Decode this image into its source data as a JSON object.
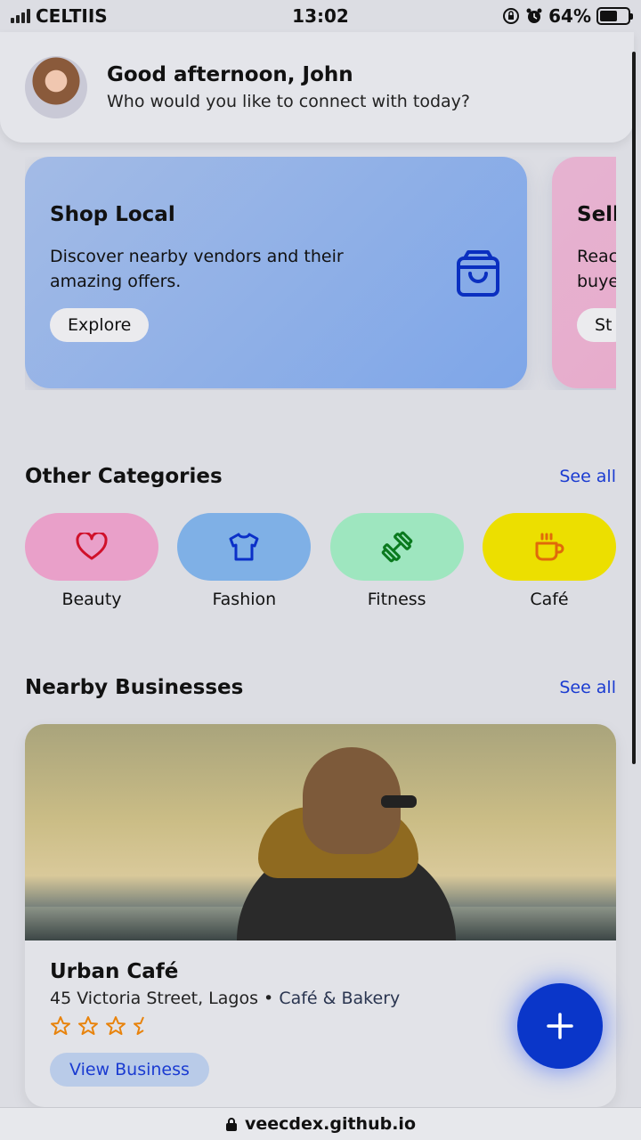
{
  "status_bar": {
    "carrier": "CELTIIS",
    "time": "13:02",
    "battery": "64%",
    "battery_level": 0.64
  },
  "header": {
    "greeting": "Good afternoon, John",
    "subtitle": "Who would you like to connect with today?"
  },
  "promos": [
    {
      "title": "Shop Local",
      "description": "Discover nearby vendors and their amazing offers.",
      "button": "Explore",
      "icon": "shopping-bag-icon"
    },
    {
      "title": "Sell",
      "description": "Reac buye",
      "button": "St"
    }
  ],
  "categories_section": {
    "title": "Other Categories",
    "see_all": "See all",
    "items": [
      {
        "label": "Beauty",
        "icon": "heart-icon",
        "color": "#e9a0c9",
        "icon_color": "#d0102a"
      },
      {
        "label": "Fashion",
        "icon": "shirt-icon",
        "color": "#7fb0e6",
        "icon_color": "#0b30c8"
      },
      {
        "label": "Fitness",
        "icon": "dumbbell-icon",
        "color": "#9ee6bf",
        "icon_color": "#0a7a1e"
      },
      {
        "label": "Café",
        "icon": "coffee-icon",
        "color": "#ecdf00",
        "icon_color": "#e06a0a"
      }
    ]
  },
  "nearby_section": {
    "title": "Nearby Businesses",
    "see_all": "See all",
    "business": {
      "name": "Urban Café",
      "address": "45 Victoria Street, Lagos",
      "separator": "•",
      "category": "Café & Bakery",
      "rating": 3.5,
      "button": "View Business"
    }
  },
  "fab": {
    "icon": "plus-icon"
  },
  "url_bar": {
    "url": "veecdex.github.io",
    "icon": "lock-icon"
  },
  "colors": {
    "accent": "#1a3bd1",
    "fab": "#0a36c9",
    "star": "#e8830c"
  }
}
